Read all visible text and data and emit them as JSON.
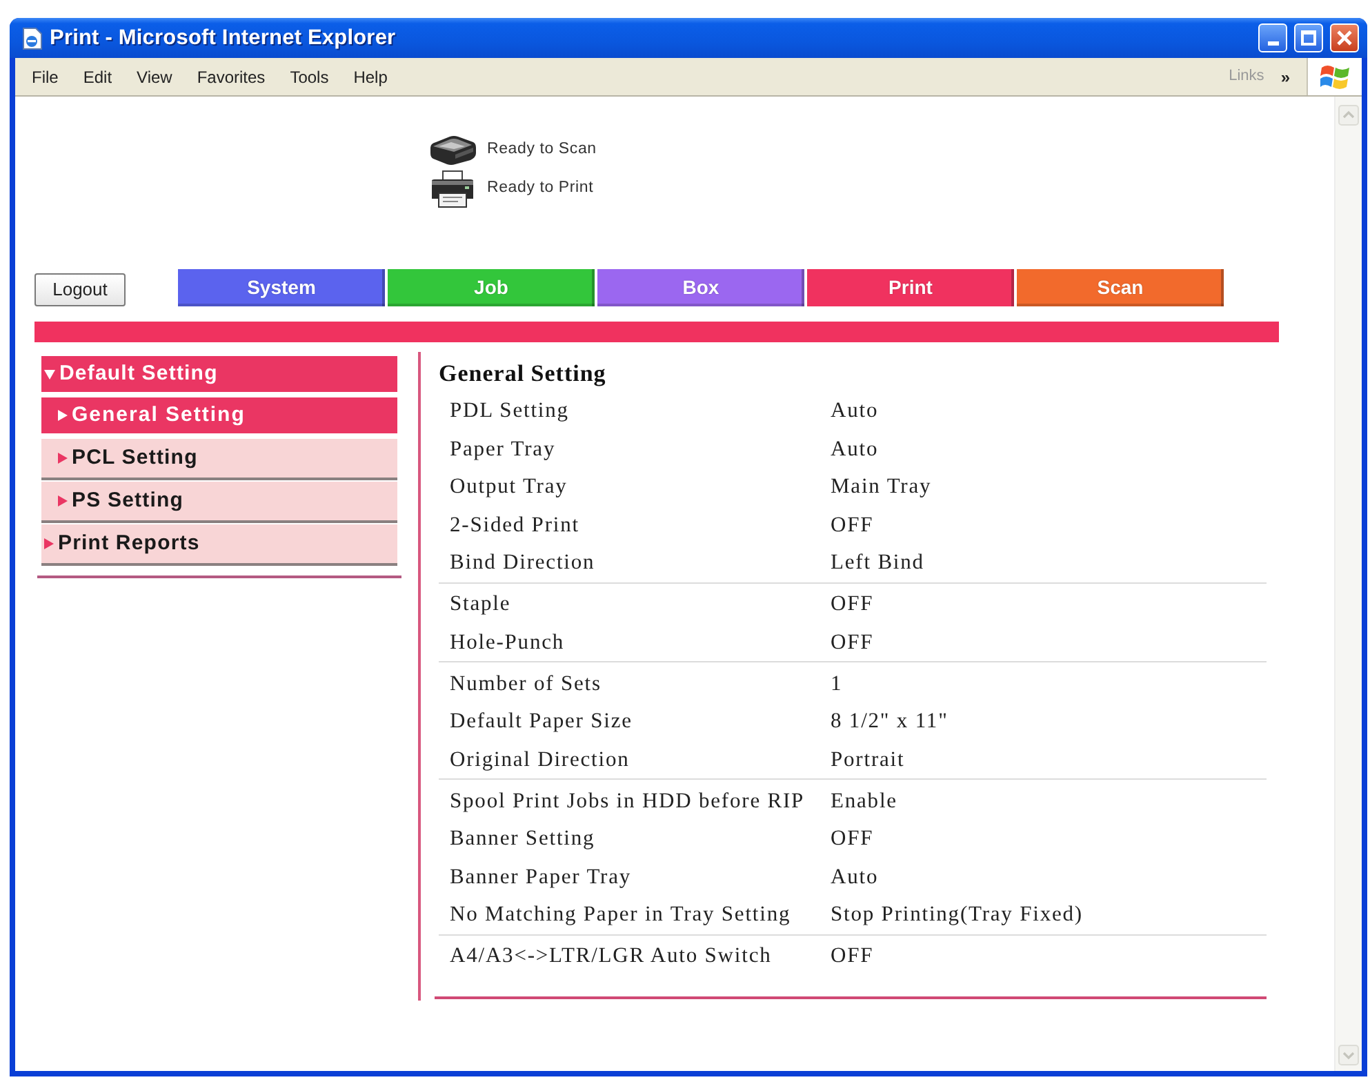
{
  "window": {
    "title": "Print - Microsoft Internet Explorer"
  },
  "menu_bar": {
    "items": [
      "File",
      "Edit",
      "View",
      "Favorites",
      "Tools",
      "Help"
    ],
    "links": "Links",
    "chevron": "»"
  },
  "status": [
    {
      "kind": "scanner",
      "text": "Ready to Scan"
    },
    {
      "kind": "printer",
      "text": "Ready to Print"
    }
  ],
  "logout_button": "Logout",
  "tabs": [
    {
      "label": "System",
      "color": "#5b63ee",
      "selected": false
    },
    {
      "label": "Job",
      "color": "#33c63b",
      "selected": false
    },
    {
      "label": "Box",
      "color": "#9b67f0",
      "selected": false
    },
    {
      "label": "Print",
      "color": "#f0325f",
      "selected": true
    },
    {
      "label": "Scan",
      "color": "#f26a2c",
      "selected": false
    }
  ],
  "sidebar": {
    "items": [
      {
        "label": "Default Setting",
        "expanded": true,
        "selected": false,
        "children": [
          {
            "label": "General Setting",
            "selected": true
          },
          {
            "label": "PCL Setting",
            "selected": false
          },
          {
            "label": "PS Setting",
            "selected": false
          }
        ]
      },
      {
        "label": "Print Reports",
        "expanded": false,
        "selected": false
      }
    ]
  },
  "content": {
    "title": "General Setting",
    "groups": [
      {
        "rows": [
          {
            "label": "PDL Setting",
            "value": "Auto"
          },
          {
            "label": "Paper Tray",
            "value": "Auto"
          },
          {
            "label": "Output Tray",
            "value": "Main Tray"
          },
          {
            "label": "2-Sided Print",
            "value": "OFF"
          },
          {
            "label": "Bind Direction",
            "value": "Left Bind"
          }
        ]
      },
      {
        "rows": [
          {
            "label": "Staple",
            "value": "OFF"
          },
          {
            "label": "Hole-Punch",
            "value": "OFF"
          }
        ]
      },
      {
        "rows": [
          {
            "label": "Number of Sets",
            "value": "1"
          },
          {
            "label": "Default Paper Size",
            "value": "8 1/2\" x 11\""
          },
          {
            "label": "Original Direction",
            "value": "Portrait"
          }
        ]
      },
      {
        "rows": [
          {
            "label": "Spool Print Jobs in HDD before RIP",
            "value": "Enable"
          },
          {
            "label": "Banner Setting",
            "value": "OFF"
          },
          {
            "label": "Banner Paper Tray",
            "value": "Auto"
          },
          {
            "label": "No Matching Paper in Tray Setting",
            "value": "Stop Printing(Tray Fixed)"
          }
        ]
      },
      {
        "rows": [
          {
            "label": "A4/A3<->LTR/LGR Auto Switch",
            "value": "OFF"
          }
        ]
      }
    ]
  }
}
